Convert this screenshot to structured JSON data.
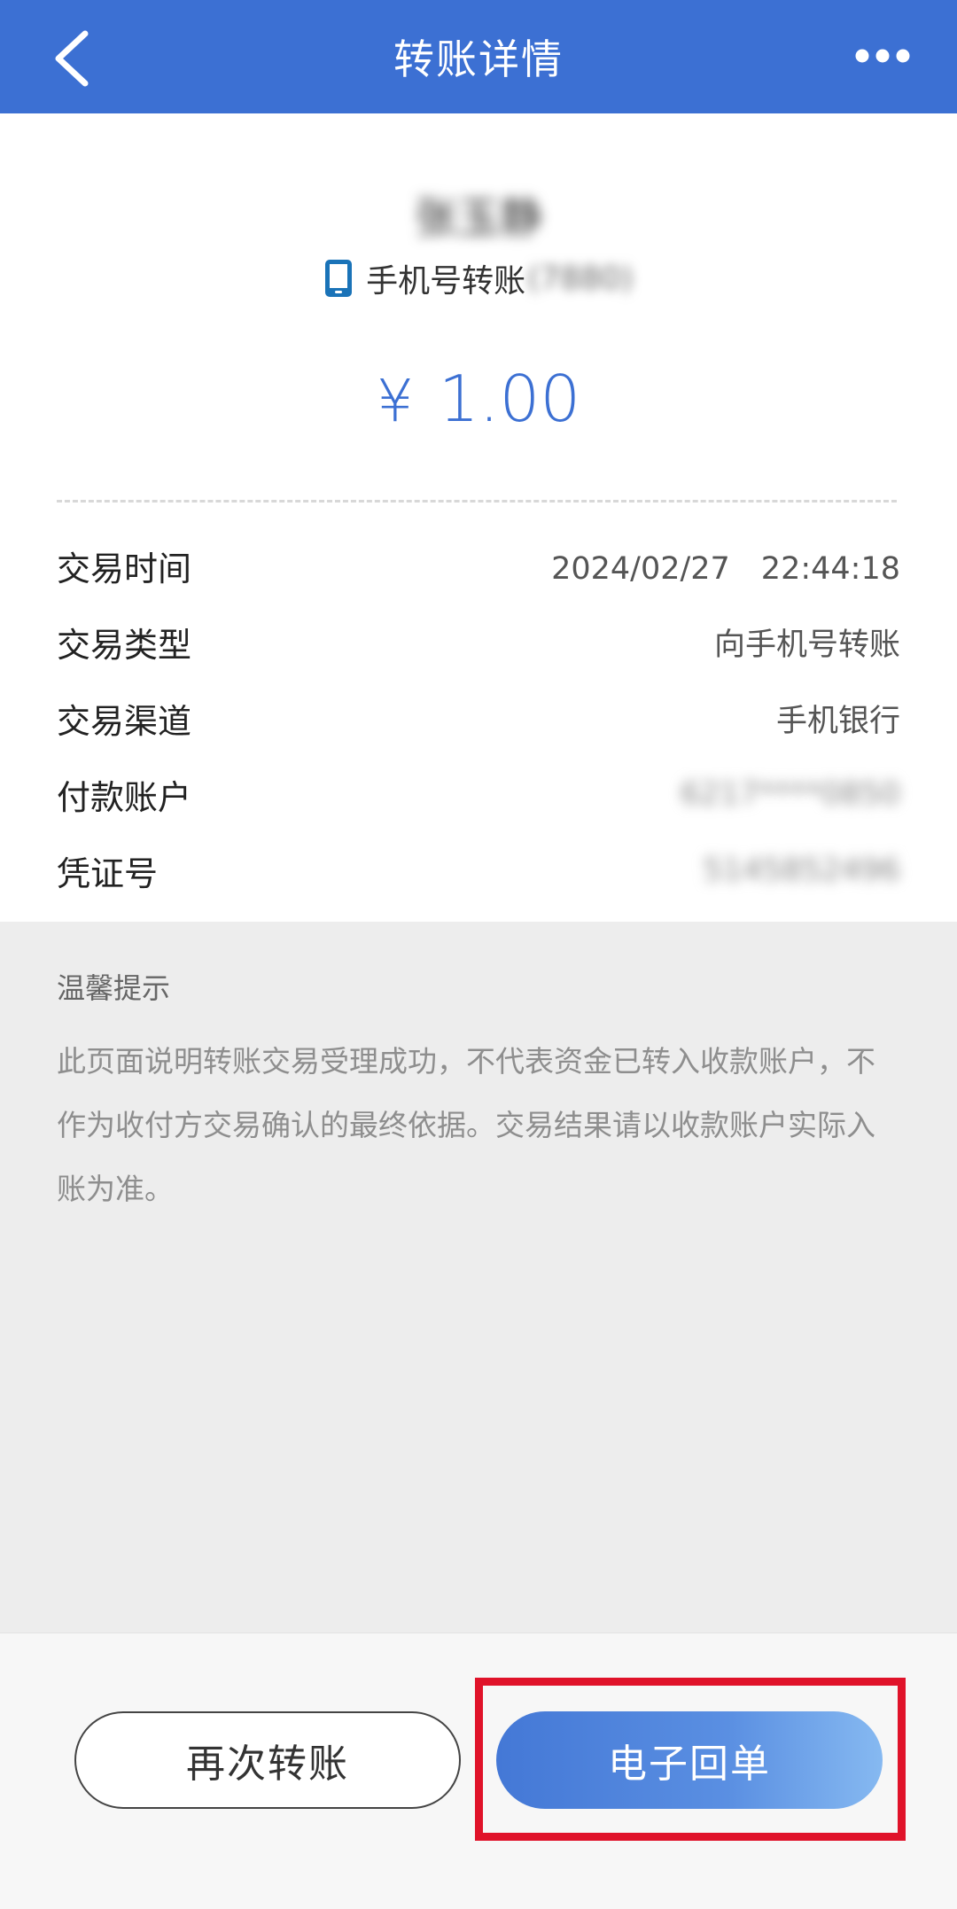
{
  "header": {
    "title": "转账详情"
  },
  "transfer": {
    "payee_name": "张玉静",
    "method": "手机号转账",
    "method_suffix": "(7880)",
    "currency_symbol": "¥",
    "amount": "1.00"
  },
  "details": [
    {
      "label": "交易时间",
      "value": "2024/02/27　22:44:18"
    },
    {
      "label": "交易类型",
      "value": "向手机号转账"
    },
    {
      "label": "交易渠道",
      "value": "手机银行"
    },
    {
      "label": "付款账户",
      "value": "6217****0850"
    },
    {
      "label": "凭证号",
      "value": "5145852496"
    }
  ],
  "tips": {
    "title": "温馨提示",
    "body": "此页面说明转账交易受理成功，不代表资金已转入收款账户，不作为收付方交易确认的最终依据。交易结果请以收款账户实际入账为准。"
  },
  "actions": {
    "again_label": "再次转账",
    "receipt_label": "电子回单"
  },
  "colors": {
    "brand": "#3c70d3",
    "highlight": "#e0132a"
  },
  "icons": [
    "back-arrow-icon",
    "more-icon",
    "phone-icon"
  ]
}
